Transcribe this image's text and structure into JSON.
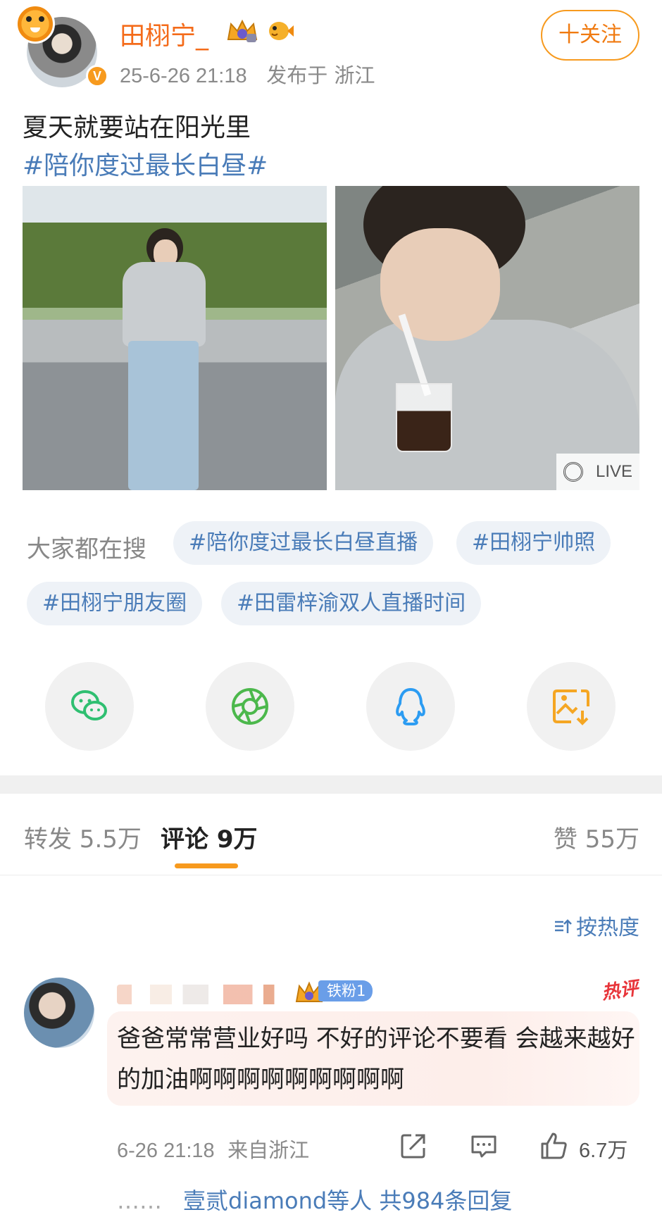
{
  "post": {
    "author_name": "田栩宁_",
    "time": "25-6-26 21:18",
    "location": "发布于 浙江",
    "follow_label": "十关注",
    "text": "夏天就要站在阳光里",
    "tag": "#陪你度过最长白昼#",
    "live_label": "LIVE",
    "verified_badge": "V"
  },
  "search": {
    "label": "大家都在搜",
    "chips": [
      "#陪你度过最长白昼直播",
      "#田栩宁帅照",
      "#田栩宁朋友圈",
      "#田雷梓渝双人直播时间"
    ]
  },
  "share": {
    "icons": [
      "wechat-icon",
      "moments-icon",
      "qq-icon",
      "save-image-icon"
    ],
    "colors": {
      "wechat": "#2fbf71",
      "moments": "#4cb84c",
      "qq": "#2c9cf2",
      "save": "#f5a623"
    }
  },
  "tabs": {
    "repost": "转发 5.5万",
    "comment": "评论 9万",
    "like": "赞 55万"
  },
  "sort_label": "按热度",
  "comment": {
    "fan_badge": "铁粉1",
    "hot_label": "热评",
    "text": "爸爸常常营业好吗 不好的评论不要看 会越来越好的加油啊啊啊啊啊啊啊啊啊",
    "time": "6-26 21:18",
    "from": "来自浙江",
    "like_count": "6.7万",
    "reply_dots": "……",
    "reply_text": "壹贰diamond等人  共984条回复"
  },
  "colors": {
    "accent": "#f79a1e",
    "link": "#4a7cb8",
    "name": "#f46b1a"
  }
}
